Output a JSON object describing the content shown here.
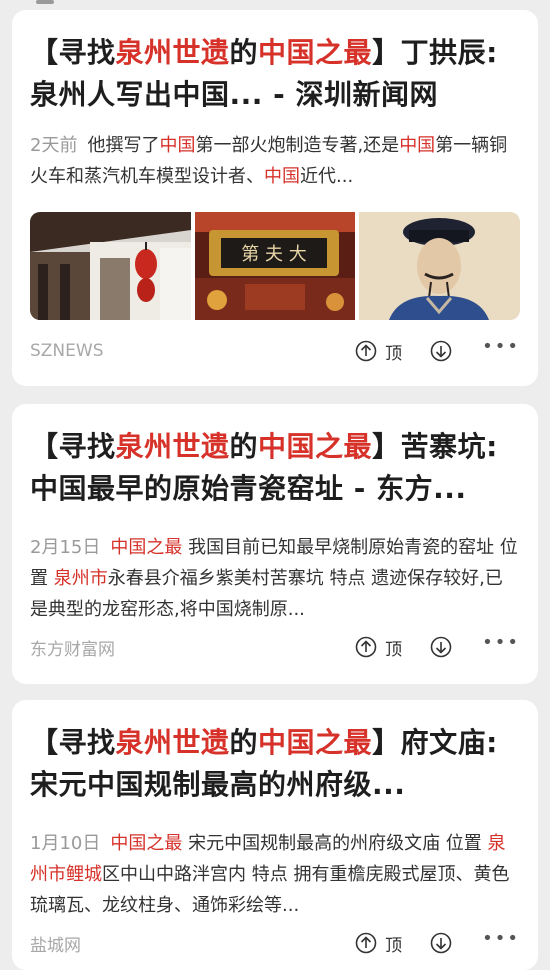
{
  "cards": [
    {
      "title": {
        "p1": "【寻找",
        "p2": "泉州世遗",
        "p3": "的",
        "p4": "中国之最",
        "p5": "】丁拱辰: 泉州人写出中国... - 深圳新闻网"
      },
      "snippet": {
        "date": "2天前",
        "s1": "他撰写了",
        "s2": "中国",
        "s3": "第一部火炮制造专著,还是",
        "s4": "中国",
        "s5": "第一辆铜火车和蒸汽机车模型设计者、",
        "s6": "中国",
        "s7": "近代..."
      },
      "images": [
        "ancient-building-lanterns-image",
        "plaque-image",
        "portrait-painting-image"
      ],
      "source": "SZNEWS",
      "up_label": "顶",
      "more": "•••"
    },
    {
      "title": {
        "p1": "【寻找",
        "p2": "泉州世遗",
        "p3": "的",
        "p4": "中国之最",
        "p5": "】苦寨坑: 中国最早的原始青瓷窑址 - 东方..."
      },
      "snippet": {
        "date": "2月15日",
        "s1": "中国之最",
        "s2": " 我国目前已知最早烧制原始青瓷的窑址 位置 ",
        "s3": "泉州市",
        "s4": "永春县介福乡紫美村苦寨坑 特点 遗迹保存较好,已是典型的龙窑形态,将中国烧制原..."
      },
      "source": "东方财富网",
      "up_label": "顶",
      "more": "•••"
    },
    {
      "title": {
        "p1": "【寻找",
        "p2": "泉州世遗",
        "p3": "的",
        "p4": "中国之最",
        "p5": "】府文庙: 宋元中国规制最高的州府级..."
      },
      "snippet": {
        "date": "1月10日",
        "s1": "中国之最",
        "s2": " 宋元中国规制最高的州府级文庙 位置 ",
        "s3": "泉州市鲤城",
        "s4": "区中山中路泮宫内 特点 拥有重檐庑殿式屋顶、黄色琉璃瓦、龙纹柱身、通饰彩绘等..."
      },
      "source": "盐城网",
      "up_label": "顶",
      "more": "•••"
    }
  ],
  "colors": {
    "highlight": "#d6322a",
    "source_text": "#a8a8a8",
    "card_bg": "#ffffff",
    "page_bg": "#ededed"
  },
  "icons": {
    "upvote": "arrow-up-circle-icon",
    "downvote": "arrow-down-circle-icon",
    "more": "more-dots-icon"
  }
}
